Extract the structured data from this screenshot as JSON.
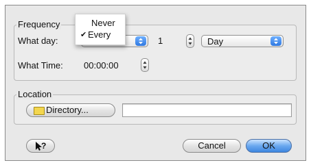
{
  "frequency": {
    "legend": "Frequency",
    "what_day_label": "What day:",
    "day_count": "1",
    "unit_value": "Day",
    "what_time_label": "What Time:",
    "time_value": "00:00:00"
  },
  "menu": {
    "items": [
      {
        "label": "Never",
        "checked": false
      },
      {
        "label": "Every",
        "checked": true
      }
    ],
    "check_mark": "✔"
  },
  "location": {
    "legend": "Location",
    "directory_button": "Directory...",
    "path_value": ""
  },
  "buttons": {
    "help_icon": "help-icon",
    "cancel": "Cancel",
    "ok": "OK"
  }
}
